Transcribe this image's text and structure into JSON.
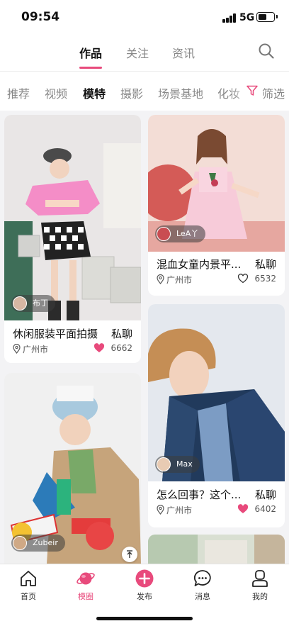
{
  "status": {
    "time": "09:54",
    "network": "5G",
    "battery_level": 0.6
  },
  "top_tabs": [
    {
      "label": "作品",
      "active": true
    },
    {
      "label": "关注",
      "active": false
    },
    {
      "label": "资讯",
      "active": false
    }
  ],
  "categories": [
    {
      "label": "推荐",
      "active": false
    },
    {
      "label": "视频",
      "active": false
    },
    {
      "label": "模特",
      "active": true
    },
    {
      "label": "摄影",
      "active": false
    },
    {
      "label": "场景基地",
      "active": false
    },
    {
      "label": "化妆",
      "active": false
    }
  ],
  "filter_label": "筛选",
  "cards": [
    {
      "author": "布丁",
      "title": "休闲服装平面拍摄",
      "chat": "私聊",
      "location": "广州市",
      "likes": "6662",
      "liked": true
    },
    {
      "author": "LeA丫",
      "title": "混血女童内景平...",
      "chat": "私聊",
      "location": "广州市",
      "likes": "6532",
      "liked": false
    },
    {
      "author": "Max",
      "title": "怎么回事？这个...",
      "chat": "私聊",
      "location": "广州市",
      "likes": "6402",
      "liked": true
    },
    {
      "author": "Zubeir"
    }
  ],
  "bottom_nav": [
    {
      "label": "首页",
      "icon": "home-icon",
      "active": false
    },
    {
      "label": "模圈",
      "icon": "planet-icon",
      "active": true
    },
    {
      "label": "发布",
      "icon": "publish-plus-icon",
      "active": false
    },
    {
      "label": "消息",
      "icon": "message-icon",
      "active": false
    },
    {
      "label": "我的",
      "icon": "profile-icon",
      "active": false
    }
  ],
  "colors": {
    "accent": "#e84a7c",
    "text": "#111111",
    "muted": "#888888",
    "background": "#f3f3f5"
  }
}
